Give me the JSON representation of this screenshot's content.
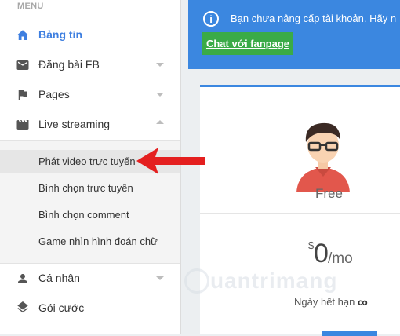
{
  "sidebar": {
    "menu_label": "MENU",
    "items": [
      {
        "label": "Bảng tin",
        "icon": "home-icon"
      },
      {
        "label": "Đăng bài FB",
        "icon": "mail-icon"
      },
      {
        "label": "Pages",
        "icon": "flag-icon"
      },
      {
        "label": "Live streaming",
        "icon": "clapperboard-icon"
      },
      {
        "label": "Cá nhân",
        "icon": "person-icon"
      },
      {
        "label": "Gói cước",
        "icon": "layers-icon"
      }
    ],
    "submenu": [
      {
        "label": "Phát video trực tuyến"
      },
      {
        "label": "Bình chọn trực tuyến"
      },
      {
        "label": "Bình chọn comment"
      },
      {
        "label": "Game nhìn hình đoán chữ"
      }
    ]
  },
  "banner": {
    "text": "Bạn chưa nâng cấp tài khoản. Hãy n",
    "button": "Chat với fanpage",
    "info_symbol": "i"
  },
  "plan": {
    "name": "Free",
    "currency": "$",
    "price": "0",
    "unit": "/mo",
    "expiry_label": "Ngày hết hạn",
    "expiry_value": "∞"
  },
  "watermark": {
    "text": "uantrimang"
  },
  "colors": {
    "accent": "#3b87e0",
    "green": "#3aab47",
    "arrow": "#e41f1f"
  }
}
